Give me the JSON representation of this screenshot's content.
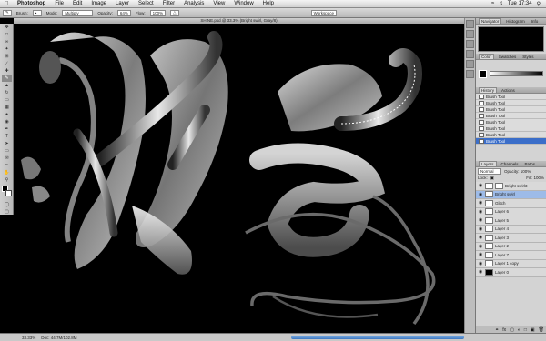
{
  "menubar": {
    "app": "Photoshop",
    "items": [
      "File",
      "Edit",
      "Image",
      "Layer",
      "Select",
      "Filter",
      "Analysis",
      "View",
      "Window",
      "Help"
    ],
    "clock": "Tue 17:34"
  },
  "options": {
    "tool": "Brush:",
    "mode_label": "Mode:",
    "mode": "Multiply",
    "opacity_label": "Opacity:",
    "opacity": "64%",
    "flow_label": "Flow:",
    "flow": "100%",
    "workspace": "Workspace"
  },
  "document": {
    "title": "SHINE.psd @ 33.3% (Bright swirl, Gray/8)"
  },
  "status": {
    "zoom": "33.33%",
    "doc": "Doc: 44.7M/102.8M"
  },
  "panels": {
    "nav_tabs": [
      "Navigator",
      "Histogram",
      "Info"
    ],
    "color_tabs": [
      "Color",
      "Swatches",
      "Styles"
    ],
    "history_tabs": [
      "History",
      "Actions"
    ],
    "history_items": [
      "Brush Tool",
      "Brush Tool",
      "Brush Tool",
      "Brush Tool",
      "Brush Tool",
      "Brush Tool",
      "Brush Tool",
      "Brush Tool"
    ],
    "layers_tabs": [
      "Layers",
      "Channels",
      "Paths"
    ],
    "blend_mode": "Normal",
    "layer_opacity": "Opacity: 100%",
    "lock_label": "Lock:",
    "fill": "Fill: 100%",
    "layers": [
      "Bright swirl3",
      "Bright swirl",
      "Glitch",
      "Layer 6",
      "Layer 5",
      "Layer 4",
      "Layer 3",
      "Layer 2",
      "Layer 7",
      "Layer 1 copy",
      "Layer 0"
    ]
  }
}
